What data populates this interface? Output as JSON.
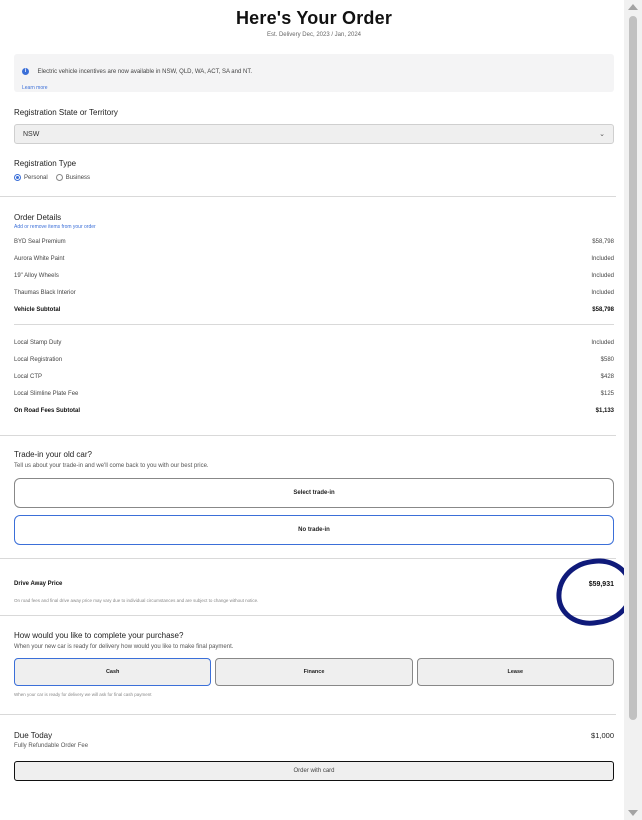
{
  "header": {
    "title": "Here's Your Order",
    "subtitle": "Est. Delivery Dec, 2023 / Jan, 2024"
  },
  "notice": {
    "text": "Electric vehicle incentives are now available in NSW, QLD, WA, ACT, SA and NT.",
    "link": "Learn more",
    "icon": "info-icon"
  },
  "registration_state": {
    "label": "Registration State or Territory",
    "value": "NSW"
  },
  "registration_type": {
    "label": "Registration Type",
    "options": [
      "Personal",
      "Business"
    ],
    "selected": "Personal"
  },
  "order_details": {
    "title": "Order Details",
    "link": "Add or remove items from your order",
    "vehicle_items": [
      {
        "label": "BYD Seal Premium",
        "value": "$58,798"
      },
      {
        "label": "Aurora White Paint",
        "value": "Included"
      },
      {
        "label": "19\" Alloy Wheels",
        "value": "Included"
      },
      {
        "label": "Thaumas Black Interior",
        "value": "Included"
      }
    ],
    "vehicle_subtotal": {
      "label": "Vehicle Subtotal",
      "value": "$58,798"
    },
    "fee_items": [
      {
        "label": "Local Stamp Duty",
        "value": "Included"
      },
      {
        "label": "Local Registration",
        "value": "$580"
      },
      {
        "label": "Local CTP",
        "value": "$428"
      },
      {
        "label": "Local Slimline Plate Fee",
        "value": "$125"
      }
    ],
    "fees_subtotal": {
      "label": "On Road Fees Subtotal",
      "value": "$1,133"
    }
  },
  "trade_in": {
    "title": "Trade-in your old car?",
    "description": "Tell us about your trade-in and we'll come back to you with our best price.",
    "select_label": "Select trade-in",
    "none_label": "No trade-in"
  },
  "drive_away": {
    "label": "Drive Away Price",
    "price": "$59,931",
    "note": "On road fees and final drive away price may vary due to individual circumstances and are subject to change without notice."
  },
  "purchase": {
    "title": "How would you like to complete your purchase?",
    "description": "When your new car is ready for delivery how would you like to make final payment.",
    "options": [
      "Cash",
      "Finance",
      "Lease"
    ],
    "selected": "Cash",
    "note": "When your car is ready for delivery we will ask for final cash payment"
  },
  "due_today": {
    "label": "Due Today",
    "value": "$1,000",
    "sub": "Fully Refundable Order Fee",
    "button": "Order with card"
  },
  "colors": {
    "accent": "#3b6fd8",
    "annotation": "#0f1a7a"
  }
}
